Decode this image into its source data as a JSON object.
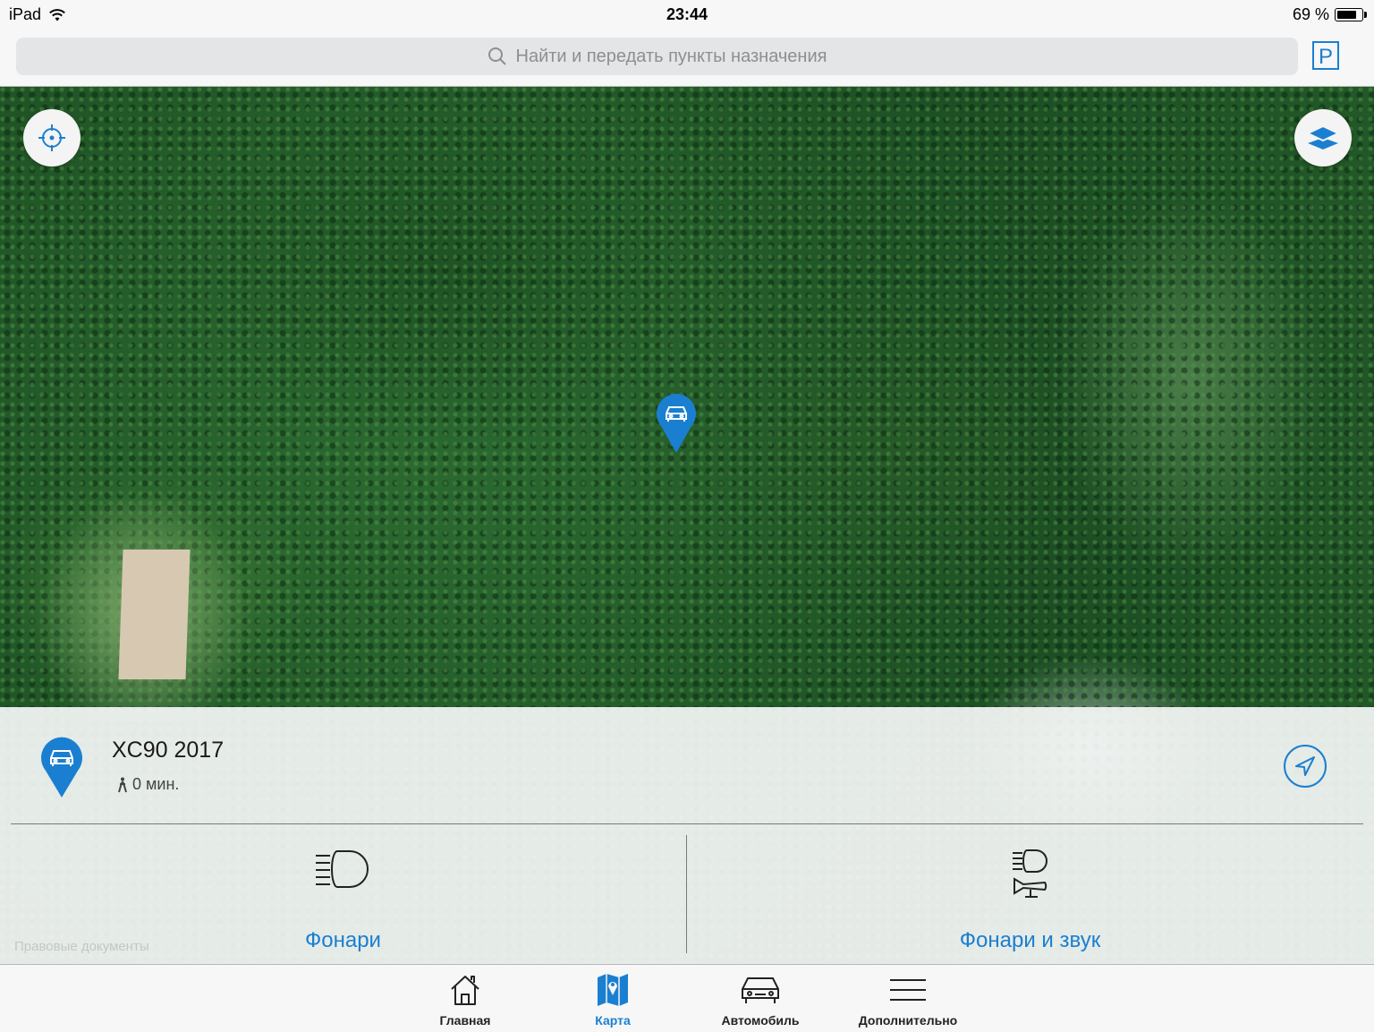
{
  "status_bar": {
    "device": "iPad",
    "time": "23:44",
    "battery": "69 %",
    "battery_level": 0.69
  },
  "search": {
    "placeholder": "Найти и передать пункты назначения",
    "parking_label": "P"
  },
  "map": {
    "type": "satellite",
    "icons": [
      "locate-icon",
      "layers-icon",
      "car-pin-icon"
    ]
  },
  "vehicle_panel": {
    "name": "XC90 2017",
    "walk_eta": "0 мин.",
    "actions": [
      {
        "label": "Фонари",
        "icon": "headlights-icon"
      },
      {
        "label": "Фонари и звук",
        "icon": "headlights-horn-icon"
      }
    ],
    "watermark": "Правовые документы"
  },
  "tabbar": {
    "tabs": [
      {
        "label": "Главная",
        "icon": "home-icon",
        "active": false
      },
      {
        "label": "Карта",
        "icon": "map-icon",
        "active": true
      },
      {
        "label": "Автомобиль",
        "icon": "car-icon",
        "active": false
      },
      {
        "label": "Дополнительно",
        "icon": "menu-icon",
        "active": false
      }
    ]
  },
  "colors": {
    "accent": "#1a7fd1",
    "pin": "#1a7fd1",
    "bars": "#f7f7f7"
  }
}
